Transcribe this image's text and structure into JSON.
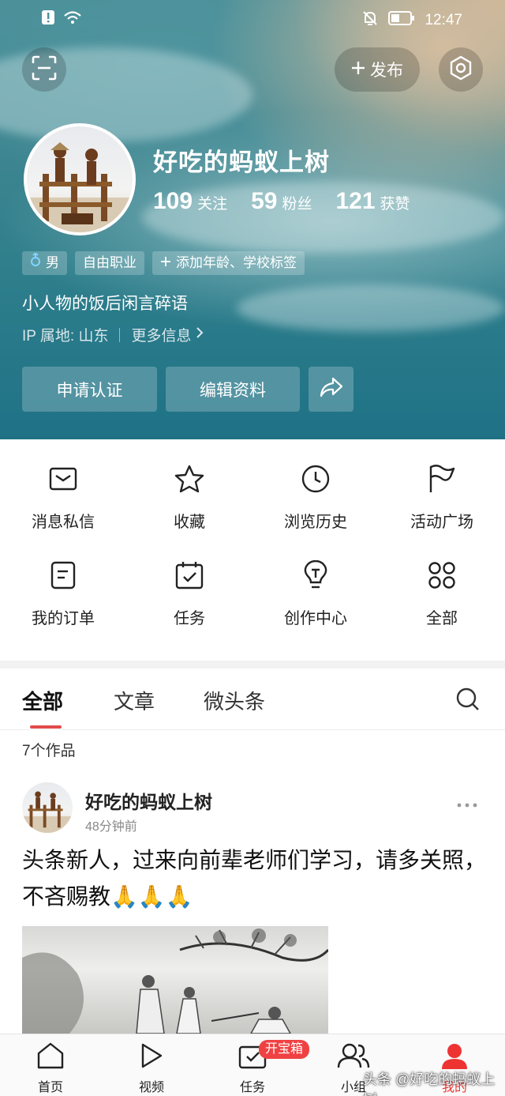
{
  "status_bar": {
    "time": "12:47"
  },
  "header": {
    "publish_label": "发布",
    "username": "好吃的蚂蚁上树",
    "stats": [
      {
        "num": "109",
        "label": "关注"
      },
      {
        "num": "59",
        "label": "粉丝"
      },
      {
        "num": "121",
        "label": "获赞"
      }
    ],
    "tags": [
      {
        "label": "男",
        "icon": "male-icon"
      },
      {
        "label": "自由职业"
      },
      {
        "label": "添加年龄、学校标签",
        "icon": "plus-icon"
      }
    ],
    "bio": "小人物的饭后闲言碎语",
    "ip_location": "IP 属地: 山东",
    "more_info": "更多信息",
    "apply_cert": "申请认证",
    "edit_profile": "编辑资料"
  },
  "grid": [
    {
      "label": "消息私信",
      "icon": "mail-icon"
    },
    {
      "label": "收藏",
      "icon": "star-icon"
    },
    {
      "label": "浏览历史",
      "icon": "clock-icon"
    },
    {
      "label": "活动广场",
      "icon": "flag-icon"
    },
    {
      "label": "我的订单",
      "icon": "order-icon"
    },
    {
      "label": "任务",
      "icon": "calendar-check-icon"
    },
    {
      "label": "创作中心",
      "icon": "bulb-icon"
    },
    {
      "label": "全部",
      "icon": "apps-icon"
    }
  ],
  "tabs": [
    "全部",
    "文章",
    "微头条"
  ],
  "works_count": "7个作品",
  "post": {
    "author": "好吃的蚂蚁上树",
    "time": "48分钟前",
    "text": "头条新人，过来向前辈老师们学习，请多关照，不吝赐教",
    "emoji": "🙏🙏🙏"
  },
  "bottom_nav": [
    {
      "label": "首页",
      "icon": "home-icon"
    },
    {
      "label": "视频",
      "icon": "play-icon"
    },
    {
      "label": "任务",
      "icon": "task-icon"
    },
    {
      "label": "小组",
      "icon": "group-icon"
    },
    {
      "label": "我的",
      "icon": "profile-icon",
      "active": true
    }
  ],
  "task_badge": "开宝箱",
  "watermark": "头条 @好吃的蚂蚁上树",
  "colors": {
    "accent": "#e34a4a",
    "ocean": "#2f7f8c",
    "sand": "#c8af91"
  }
}
